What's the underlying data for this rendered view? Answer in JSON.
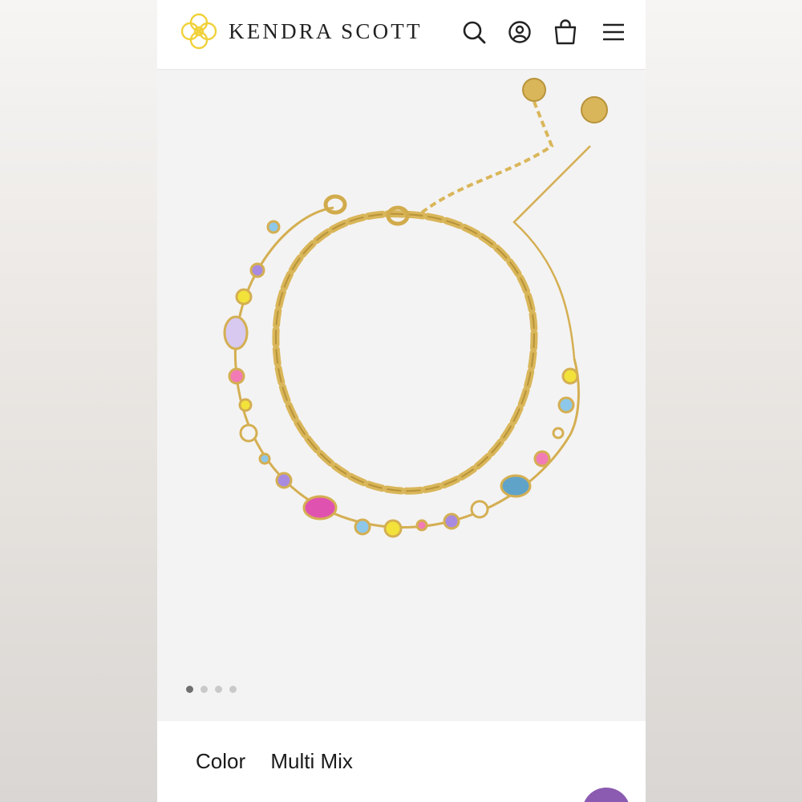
{
  "brand": {
    "name": "KENDRA SCOTT",
    "logo_color": "#f0d13a"
  },
  "header": {
    "icons": [
      "search-icon",
      "account-icon",
      "bag-icon",
      "menu-icon"
    ]
  },
  "product": {
    "image_alt_subject": "",
    "carousel": {
      "count": 4,
      "active_index": 0
    },
    "color_label": "Color",
    "color_value": "Multi Mix"
  },
  "colors": {
    "gold": "#d9b659",
    "hero_bg": "#f4f3f3",
    "chat_button": "#8a5bb0"
  }
}
